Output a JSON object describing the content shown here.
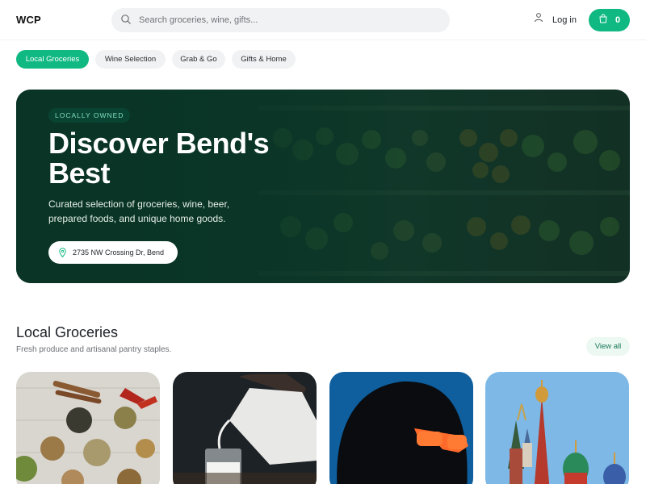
{
  "header": {
    "logo": "WCP",
    "search_placeholder": "Search groceries, wine, gifts...",
    "login_label": "Log in",
    "cart_count": "0",
    "icons": {
      "search": "search-icon",
      "user": "user-icon",
      "cart": "shopping-bag-icon"
    },
    "accent_color": "#10b981"
  },
  "categories": [
    {
      "label": "Local Groceries",
      "active": true
    },
    {
      "label": "Wine Selection",
      "active": false
    },
    {
      "label": "Grab & Go",
      "active": false
    },
    {
      "label": "Gifts & Home",
      "active": false
    }
  ],
  "hero": {
    "badge": "LOCALLY OWNED",
    "title": "Discover Bend's Best",
    "description": "Curated selection of groceries, wine, beer, prepared foods, and unique home goods.",
    "address": "2735 NW Crossing Dr, Bend",
    "address_icon": "map-pin-icon"
  },
  "section": {
    "title": "Local Groceries",
    "subtitle": "Fresh produce and artisanal pantry staples.",
    "view_all_label": "View all"
  }
}
